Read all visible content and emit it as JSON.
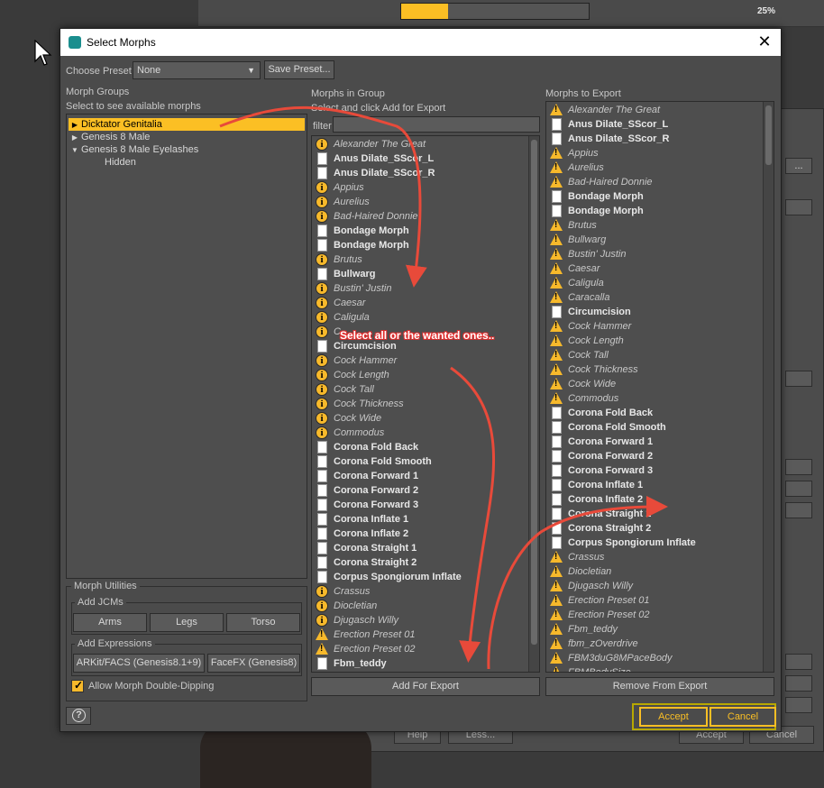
{
  "background": {
    "progress_percent": 25,
    "progress_label": "25%",
    "bg_buttons": {
      "help": "Help",
      "less": "Less...",
      "accept": "Accept",
      "cancel": "Cancel",
      "ellipsis": "..."
    }
  },
  "dialog": {
    "title": "Select Morphs",
    "choose_preset_label": "Choose Preset",
    "preset_value": "None",
    "save_preset_label": "Save Preset...",
    "morph_groups_label": "Morph Groups",
    "morph_groups_hint": "Select to see available morphs",
    "groups": [
      {
        "label": "Dicktator Genitalia",
        "expanded": false,
        "selected": true
      },
      {
        "label": "Genesis 8 Male",
        "expanded": false,
        "selected": false
      },
      {
        "label": "Genesis 8 Male Eyelashes",
        "expanded": true,
        "selected": false
      },
      {
        "label": "Hidden",
        "child": true
      }
    ],
    "morphs_in_group_label": "Morphs in Group",
    "morphs_in_group_hint": "Select and click Add for Export",
    "filter_label": "filter",
    "morphs_to_export_label": "Morphs to Export",
    "morphs_in_group": [
      {
        "label": "Alexander The Great",
        "icon": "info",
        "style": "italic"
      },
      {
        "label": "Anus Dilate_SScor_L",
        "icon": "file",
        "style": "bold"
      },
      {
        "label": "Anus Dilate_SScor_R",
        "icon": "file",
        "style": "bold"
      },
      {
        "label": "Appius",
        "icon": "info",
        "style": "italic"
      },
      {
        "label": "Aurelius",
        "icon": "info",
        "style": "italic"
      },
      {
        "label": "Bad-Haired Donnie",
        "icon": "info",
        "style": "italic"
      },
      {
        "label": "Bondage Morph",
        "icon": "file",
        "style": "bold"
      },
      {
        "label": "Bondage Morph",
        "icon": "file",
        "style": "bold"
      },
      {
        "label": "Brutus",
        "icon": "info",
        "style": "italic"
      },
      {
        "label": "Bullwarg",
        "icon": "file",
        "style": "bold"
      },
      {
        "label": "Bustin' Justin",
        "icon": "info",
        "style": "italic"
      },
      {
        "label": "Caesar",
        "icon": "info",
        "style": "italic"
      },
      {
        "label": "Caligula",
        "icon": "info",
        "style": "italic"
      },
      {
        "label": "C",
        "icon": "info",
        "style": "italic"
      },
      {
        "label": "Circumcision",
        "icon": "file",
        "style": "bold"
      },
      {
        "label": "Cock Hammer",
        "icon": "info",
        "style": "italic"
      },
      {
        "label": "Cock Length",
        "icon": "info",
        "style": "italic"
      },
      {
        "label": "Cock Tall",
        "icon": "info",
        "style": "italic"
      },
      {
        "label": "Cock Thickness",
        "icon": "info",
        "style": "italic"
      },
      {
        "label": "Cock Wide",
        "icon": "info",
        "style": "italic"
      },
      {
        "label": "Commodus",
        "icon": "info",
        "style": "italic"
      },
      {
        "label": "Corona Fold Back",
        "icon": "file",
        "style": "bold"
      },
      {
        "label": "Corona Fold Smooth",
        "icon": "file",
        "style": "bold"
      },
      {
        "label": "Corona Forward 1",
        "icon": "file",
        "style": "bold"
      },
      {
        "label": "Corona Forward 2",
        "icon": "file",
        "style": "bold"
      },
      {
        "label": "Corona Forward 3",
        "icon": "file",
        "style": "bold"
      },
      {
        "label": "Corona Inflate 1",
        "icon": "file",
        "style": "bold"
      },
      {
        "label": "Corona Inflate 2",
        "icon": "file",
        "style": "bold"
      },
      {
        "label": "Corona Straight 1",
        "icon": "file",
        "style": "bold"
      },
      {
        "label": "Corona Straight 2",
        "icon": "file",
        "style": "bold"
      },
      {
        "label": "Corpus Spongiorum Inflate",
        "icon": "file",
        "style": "bold"
      },
      {
        "label": "Crassus",
        "icon": "info",
        "style": "italic"
      },
      {
        "label": "Diocletian",
        "icon": "info",
        "style": "italic"
      },
      {
        "label": "Djugasch Willy",
        "icon": "info",
        "style": "italic"
      },
      {
        "label": "Erection Preset 01",
        "icon": "warn",
        "style": "italic"
      },
      {
        "label": "Erection Preset 02",
        "icon": "warn",
        "style": "italic"
      },
      {
        "label": "Fbm_teddy",
        "icon": "file",
        "style": "bold"
      }
    ],
    "morphs_to_export": [
      {
        "label": "Alexander The Great",
        "icon": "warn",
        "style": "italic"
      },
      {
        "label": "Anus Dilate_SScor_L",
        "icon": "file",
        "style": "bold"
      },
      {
        "label": "Anus Dilate_SScor_R",
        "icon": "file",
        "style": "bold"
      },
      {
        "label": "Appius",
        "icon": "warn",
        "style": "italic"
      },
      {
        "label": "Aurelius",
        "icon": "warn",
        "style": "italic"
      },
      {
        "label": "Bad-Haired Donnie",
        "icon": "warn",
        "style": "italic"
      },
      {
        "label": "Bondage Morph",
        "icon": "file",
        "style": "bold"
      },
      {
        "label": "Bondage Morph",
        "icon": "file",
        "style": "bold"
      },
      {
        "label": "Brutus",
        "icon": "warn",
        "style": "italic"
      },
      {
        "label": "Bullwarg",
        "icon": "warn",
        "style": "italic"
      },
      {
        "label": "Bustin' Justin",
        "icon": "warn",
        "style": "italic"
      },
      {
        "label": "Caesar",
        "icon": "warn",
        "style": "italic"
      },
      {
        "label": "Caligula",
        "icon": "warn",
        "style": "italic"
      },
      {
        "label": "Caracalla",
        "icon": "warn",
        "style": "italic"
      },
      {
        "label": "Circumcision",
        "icon": "file",
        "style": "bold"
      },
      {
        "label": "Cock Hammer",
        "icon": "warn",
        "style": "italic"
      },
      {
        "label": "Cock Length",
        "icon": "warn",
        "style": "italic"
      },
      {
        "label": "Cock Tall",
        "icon": "warn",
        "style": "italic"
      },
      {
        "label": "Cock Thickness",
        "icon": "warn",
        "style": "italic"
      },
      {
        "label": "Cock Wide",
        "icon": "warn",
        "style": "italic"
      },
      {
        "label": "Commodus",
        "icon": "warn",
        "style": "italic"
      },
      {
        "label": "Corona Fold Back",
        "icon": "file",
        "style": "bold"
      },
      {
        "label": "Corona Fold Smooth",
        "icon": "file",
        "style": "bold"
      },
      {
        "label": "Corona Forward 1",
        "icon": "file",
        "style": "bold"
      },
      {
        "label": "Corona Forward 2",
        "icon": "file",
        "style": "bold"
      },
      {
        "label": "Corona Forward 3",
        "icon": "file",
        "style": "bold"
      },
      {
        "label": "Corona Inflate 1",
        "icon": "file",
        "style": "bold"
      },
      {
        "label": "Corona Inflate 2",
        "icon": "file",
        "style": "bold"
      },
      {
        "label": "Corona Straight 1",
        "icon": "file",
        "style": "bold"
      },
      {
        "label": "Corona Straight 2",
        "icon": "file",
        "style": "bold"
      },
      {
        "label": "Corpus Spongiorum Inflate",
        "icon": "file",
        "style": "bold"
      },
      {
        "label": "Crassus",
        "icon": "warn",
        "style": "italic"
      },
      {
        "label": "Diocletian",
        "icon": "warn",
        "style": "italic"
      },
      {
        "label": "Djugasch Willy",
        "icon": "warn",
        "style": "italic"
      },
      {
        "label": "Erection Preset 01",
        "icon": "warn",
        "style": "italic"
      },
      {
        "label": "Erection Preset 02",
        "icon": "warn",
        "style": "italic"
      },
      {
        "label": "Fbm_teddy",
        "icon": "warn",
        "style": "italic"
      },
      {
        "label": "fbm_zOverdrive",
        "icon": "warn",
        "style": "italic"
      },
      {
        "label": "FBM3duG8MPaceBody",
        "icon": "warn",
        "style": "italic"
      },
      {
        "label": "FBMBodySize",
        "icon": "warn",
        "style": "italic"
      }
    ],
    "add_for_export_label": "Add For Export",
    "remove_from_export_label": "Remove From Export",
    "morph_utilities_label": "Morph Utilities",
    "add_jcms_label": "Add JCMs",
    "jcm_buttons": [
      "Arms",
      "Legs",
      "Torso"
    ],
    "add_expressions_label": "Add Expressions",
    "expression_buttons": [
      "ARKit/FACS (Genesis8.1+9)",
      "FaceFX (Genesis8)"
    ],
    "allow_double_dipping_label": "Allow Morph Double-Dipping",
    "accept_label": "Accept",
    "cancel_label": "Cancel"
  },
  "annotation": {
    "text": "Select all or the wanted ones..",
    "color": "#e84a3a"
  },
  "colors": {
    "accent": "#fbbf24",
    "dialog_bg": "#4b4b4b",
    "arrow": "#e84a3a"
  }
}
